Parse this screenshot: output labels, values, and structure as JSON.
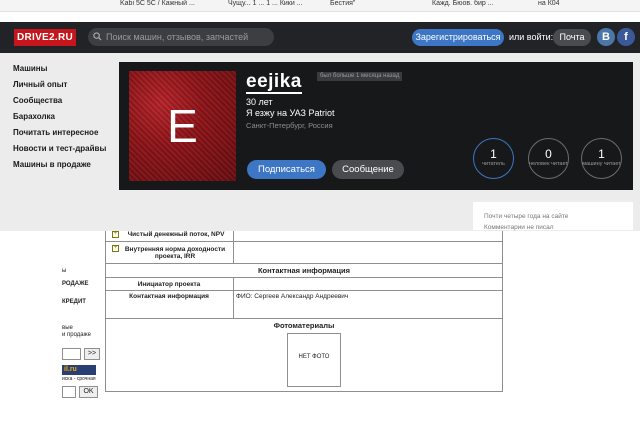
{
  "top_strip": [
    "Kabi 5C 5C / Кажный ... ",
    "Чущу... 1 ... 1 ... Кики ...",
    "Бестия\"",
    "Кажд. Бюов. бир ...",
    "на К04"
  ],
  "header": {
    "logo": "DRIVE2.RU",
    "search_placeholder": "Поиск машин, отзывов, запчастей",
    "register_label": "Зарегистрироваться",
    "login_prompt": "или войти:",
    "mail_label": "Почта",
    "vk_glyph": "В",
    "fb_glyph": "f"
  },
  "sidebar": {
    "items": [
      {
        "label": "Машины"
      },
      {
        "label": "Личный опыт"
      },
      {
        "label": "Сообщества"
      },
      {
        "label": "Барахолка"
      },
      {
        "label": "Почитать интересное"
      },
      {
        "label": "Новости и тест-драйвы"
      },
      {
        "label": "Машины в продаже"
      }
    ]
  },
  "profile": {
    "avatar_letter": "E",
    "username": "eejika",
    "badge": "был больше 1 месяца назад",
    "age": "30 лет",
    "car": "Я езжу на УАЗ Patriot",
    "city": "Санкт-Петербург, Россия",
    "subscribe_label": "Подписаться",
    "message_label": "Сообщение",
    "stats": [
      {
        "value": "1",
        "label": "читатель"
      },
      {
        "value": "0",
        "label": "человек читает"
      },
      {
        "value": "1",
        "label": "машину читает"
      }
    ]
  },
  "right_panel": {
    "line1": "Почти четыре года на сайте",
    "line2": "Комментарии не писал"
  },
  "document": {
    "rows_top": [
      {
        "label": "Чистый денежный поток, NPV",
        "value": ""
      },
      {
        "label": "Внутренняя норма доходности проекта, IRR",
        "value": ""
      }
    ],
    "contact_header": "Контактная информация",
    "contact_rows": [
      {
        "label": "Инициатор проекта",
        "value": ""
      },
      {
        "label": "Контактная информация",
        "value": "ФИО: Сергеев Александр Андреевич"
      }
    ],
    "photos_header": "Фотоматериалы",
    "no_photo": "НЕТ ФОТО"
  },
  "left_fragment": {
    "t1": "ы",
    "t2": "РОДАЖЕ",
    "t3": "КРЕДИТ",
    "t4": "вые",
    "t5": "и продаже",
    "go1": ">>",
    "banner": "il.ru",
    "t6": "иска - срочная",
    "go2": "OK"
  }
}
